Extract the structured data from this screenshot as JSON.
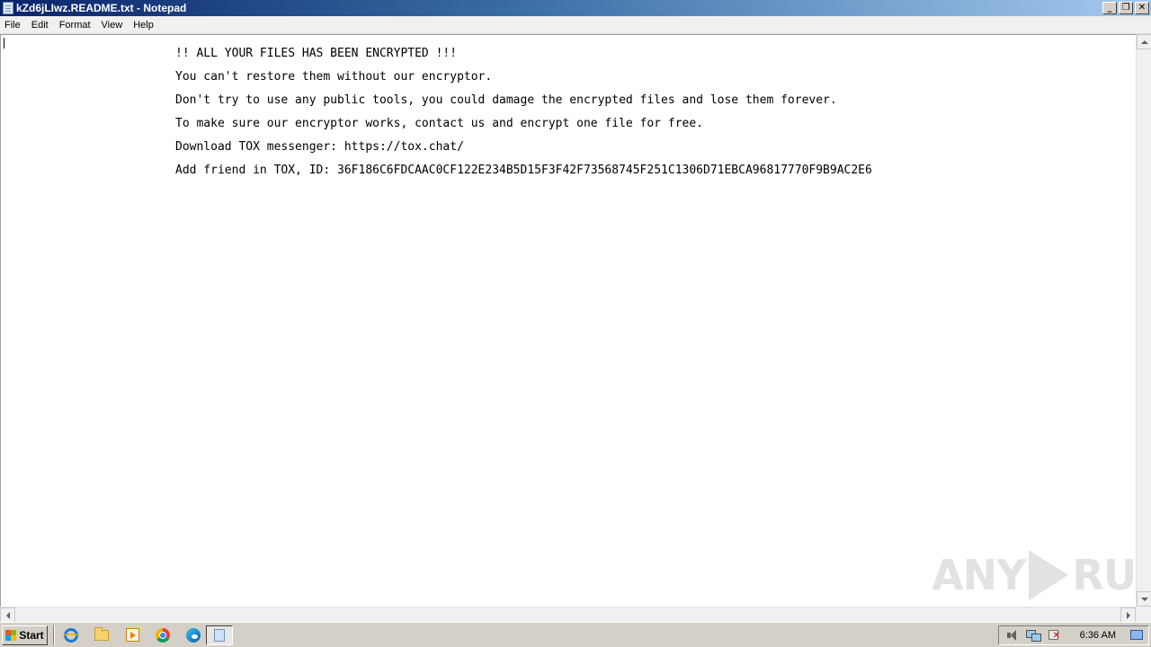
{
  "window": {
    "title": "kZd6jLIwz.README.txt - Notepad",
    "minimize_label": "_",
    "maximize_label": "❐",
    "close_label": "✕"
  },
  "menu": {
    "items": [
      {
        "label": "File"
      },
      {
        "label": "Edit"
      },
      {
        "label": "Format"
      },
      {
        "label": "View"
      },
      {
        "label": "Help"
      }
    ]
  },
  "document": {
    "lines": [
      "!! ALL YOUR FILES HAS BEEN ENCRYPTED !!!",
      "You can't restore them without our encryptor.",
      "Don't try to use any public tools, you could damage the encrypted files and lose them forever.",
      "To make sure our encryptor works, contact us and encrypt one file for free.",
      "Download TOX messenger: https://tox.chat/",
      "Add friend in TOX, ID: 36F186C6FDCAAC0CF122E234B5D15F3F42F73568745F251C1306D71EBCA96817770F9B9AC2E6"
    ]
  },
  "watermark": {
    "left": "ANY",
    "right": "RUN"
  },
  "taskbar": {
    "start_label": "Start",
    "clock": "6:36 AM",
    "quick_icons": [
      "internet-explorer-icon",
      "folder-icon",
      "media-player-icon",
      "chrome-icon",
      "edge-icon"
    ],
    "active_task_icon": "notepad-icon"
  },
  "colors": {
    "titlebar_start": "#0a246a",
    "titlebar_end": "#a6caf0",
    "taskbar": "#d4d0c8"
  }
}
